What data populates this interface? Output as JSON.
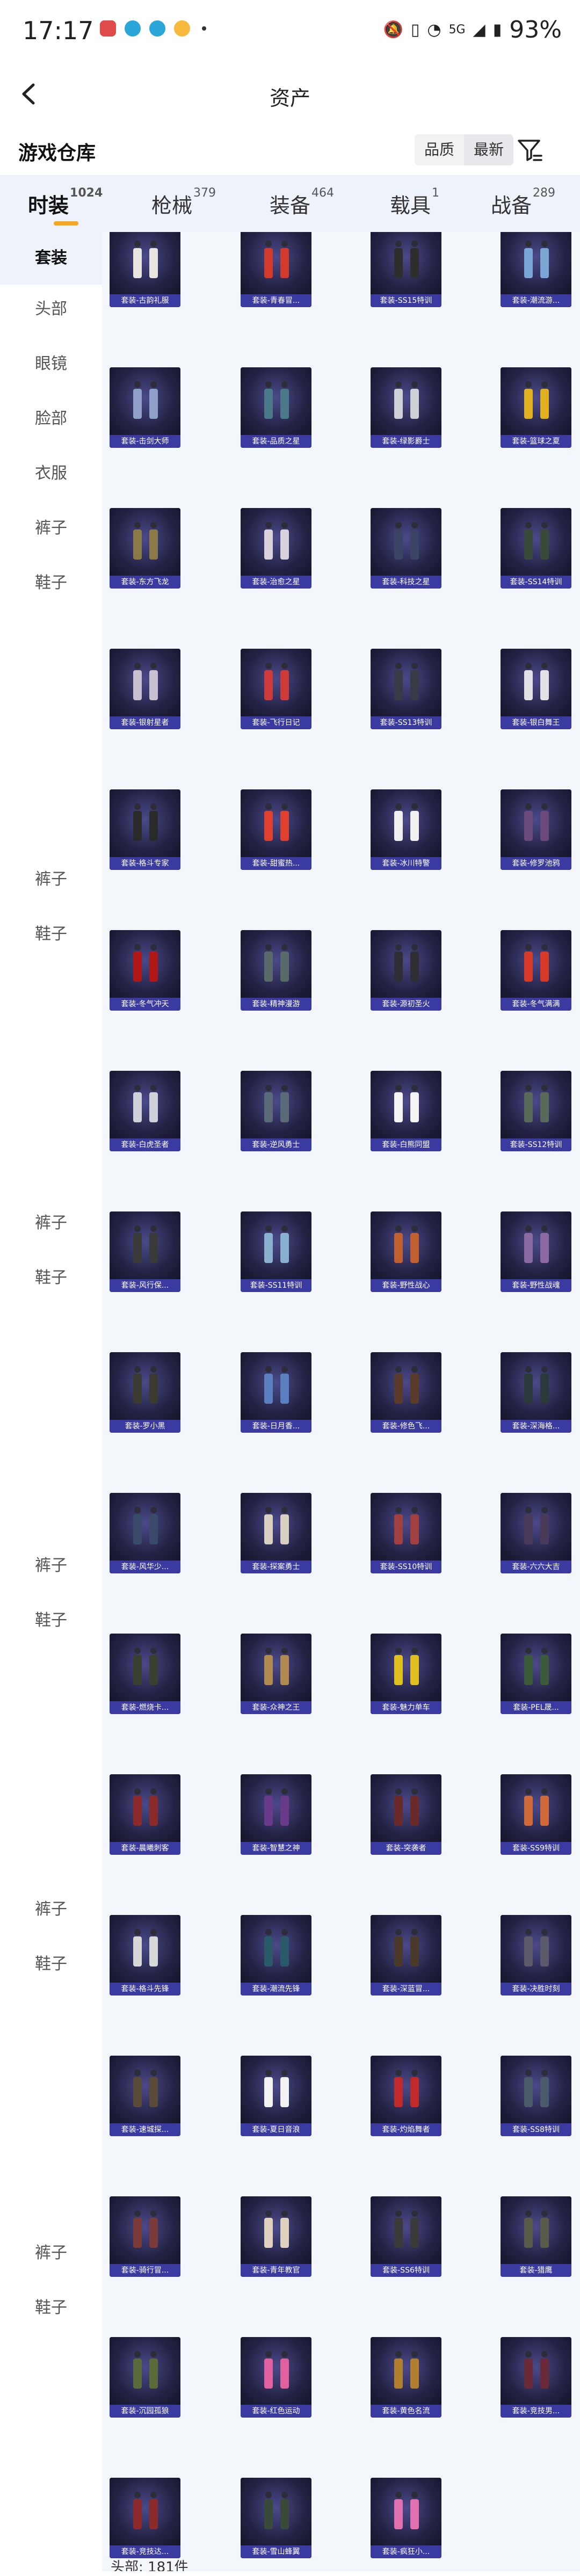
{
  "status_bar": {
    "time": "17:17",
    "battery": "93%",
    "signal": "5G",
    "apps": [
      "app-red",
      "app-bird-1",
      "app-bird-2",
      "app-emoji"
    ],
    "app_colors": [
      "#e04a4a",
      "#2aa6d8",
      "#2aa6d8",
      "#f6b93b"
    ]
  },
  "header": {
    "title": "资产"
  },
  "warehouse": {
    "title": "游戏仓库",
    "sort_options": [
      "品质",
      "最新"
    ],
    "sort_active": "最新"
  },
  "tabs": [
    {
      "label": "时装",
      "count": "1024"
    },
    {
      "label": "枪械",
      "count": "379"
    },
    {
      "label": "装备",
      "count": "464"
    },
    {
      "label": "载具",
      "count": "1"
    },
    {
      "label": "战备",
      "count": "289"
    }
  ],
  "sidebar": {
    "items": [
      "套装",
      "头部",
      "眼镜",
      "脸部",
      "衣服",
      "裤子",
      "鞋子"
    ],
    "repeat_labels": [
      "裤子",
      "鞋子"
    ]
  },
  "items": [
    "套装-古韵礼服",
    "套装-青春冒...",
    "套装-SS15特训",
    "套装-潮流游...",
    "套装-击剑大师",
    "套装-品质之星",
    "套装-绿影爵士",
    "套装-篮球之夏",
    "套装-东方飞龙",
    "套装-治愈之星",
    "套装-科技之星",
    "套装-SS14特训",
    "套装-银射星者",
    "套装-飞行日记",
    "套装-SS13特训",
    "套装-银白舞王",
    "套装-格斗专家",
    "套装-甜蜜热...",
    "套装-冰川特警",
    "套装-修罗池鸦",
    "套装-冬气冲天",
    "套装-精神漫游",
    "套装-源初圣火",
    "套装-冬气满满",
    "套装-白虎圣者",
    "套装-逆风勇士",
    "套装-白熊同盟",
    "套装-SS12特训",
    "套装-风行保...",
    "套装-SS11特训",
    "套装-野性战心",
    "套装-野性战魂",
    "套装-罗小黑",
    "套装-日月香...",
    "套装-修色飞...",
    "套装-深海格...",
    "套装-风华少...",
    "套装-探案勇士",
    "套装-SS10特训",
    "套装-六六大吉",
    "套装-燃烧卡...",
    "套装-众神之王",
    "套装-魅力单车",
    "套装-PEL晟...",
    "套装-晨曦刺客",
    "套装-智慧之神",
    "套装-突袭者",
    "套装-SS9特训",
    "套装-格斗先锋",
    "套装-潮流先锋",
    "套装-深蓝冒...",
    "套装-决胜时刻",
    "套装-速城探...",
    "套装-夏日音浪",
    "套装-灼焰舞者",
    "套装-SS8特训",
    "套装-骑行冒...",
    "套装-青年教官",
    "套装-SS6特训",
    "套装-猎鹰",
    "套装-沉园孤狼",
    "套装-红色运动",
    "套装-黄色名流",
    "套装-竞技男...",
    "套装-竞技达...",
    "套装-雪山蜂翼",
    "套装-疯狂小..."
  ],
  "outfit_colors": [
    "#e8e4e0",
    "#d23a2e",
    "#2e2e2e",
    "#7aa6d6",
    "#8ea0c8",
    "#4a7a8a",
    "#cfcfd6",
    "#e0b020",
    "#8a7a4a",
    "#d7d2dc",
    "#3c4466",
    "#3a4a3a",
    "#c8c0d0",
    "#cc3a3a",
    "#3a3a46",
    "#e2e2e6",
    "#2a2a2a",
    "#e04030",
    "#f0f0f0",
    "#6a4a7a",
    "#b01818",
    "#5a6a6a",
    "#2e2e34",
    "#d83a2a",
    "#d0d0da",
    "#5a6a78",
    "#f4f4f4",
    "#5a6a5a",
    "#3a3a3a",
    "#8ab0d0",
    "#c06030",
    "#8a6aa0",
    "#3a3a30",
    "#5a80c0",
    "#5a3a2a",
    "#2a3a3a",
    "#3a4a6a",
    "#d8d0c0",
    "#a04040",
    "#4a3a5a",
    "#3a4030",
    "#b08a50",
    "#e0c020",
    "#3a5a3a",
    "#8a2a2a",
    "#6a3a8a",
    "#6a2a2a",
    "#d06a3a",
    "#d8d8d8",
    "#2a5a6a",
    "#4a3a2a",
    "#5a5a6a",
    "#5a4a3a",
    "#f2f2f2",
    "#c02a2a",
    "#4a5a6a",
    "#7a3a3a",
    "#e0d0c0",
    "#3a3a3a",
    "#5a5a4a",
    "#5a6a3a",
    "#e060a0",
    "#b08030",
    "#6a2a3a",
    "#8a2a2a",
    "#3a4a3a",
    "#e070b0"
  ],
  "footer": {
    "count_text": "头部: 181件"
  }
}
